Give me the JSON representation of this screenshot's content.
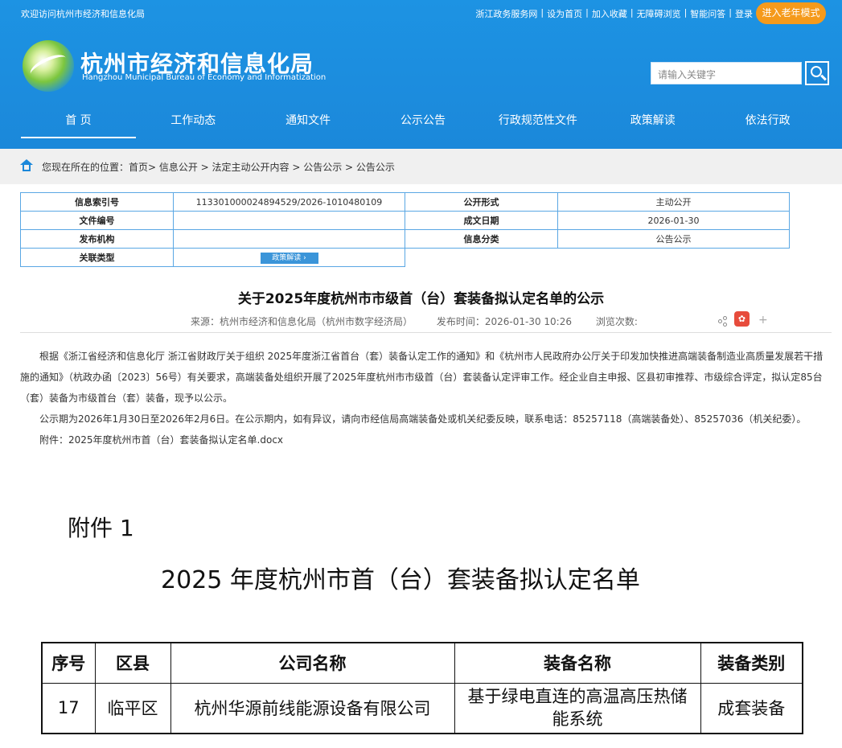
{
  "topbar": {
    "welcome": "欢迎访问杭州市经济和信息化局",
    "links": [
      "浙江政务服务网",
      "设为首页",
      "加入收藏",
      "无障碍浏览",
      "智能问答",
      "登录"
    ],
    "elder_mode": "进入老年模式"
  },
  "site": {
    "title": "杭州市经济和信息化局",
    "subtitle": "Hangzhou Municipal Bureau of Economy and Informatization"
  },
  "search": {
    "placeholder": "请输入关键字"
  },
  "nav": [
    "首 页",
    "工作动态",
    "通知文件",
    "公示公告",
    "行政规范性文件",
    "政策解读",
    "依法行政"
  ],
  "breadcrumb": "您现在所在的位置：首页> 信息公开 > 法定主动公开内容 > 公告公示 > 公告公示",
  "info": {
    "labels": [
      "信息索引号",
      "公开形式",
      "文件编号",
      "成文日期",
      "发布机构",
      "信息分类",
      "关联类型"
    ],
    "index_no": "113301000024894529/2026-1010480109",
    "open_form": "主动公开",
    "doc_no": "",
    "date": "2026-01-30",
    "issuer": "",
    "category": "公告公示",
    "policy_button": "政策解读 ›"
  },
  "article": {
    "title": "关于2025年度杭州市市级首（台）套装备拟认定名单的公示",
    "source": "来源：杭州市经济和信息化局（杭州市数字经济局）",
    "time": "发布时间：2026-01-30 10:26",
    "views": "浏览次数:",
    "para1": "根据《浙江省经济和信息化厅 浙江省财政厅关于组织 2025年度浙江省首台（套）装备认定工作的通知》和《杭州市人民政府办公厅关于印发加快推进高端装备制造业高质量发展若干措施的通知》（杭政办函〔2023〕56号）有关要求，高端装备处组织开展了2025年度杭州市市级首（台）套装备认定评审工作。经企业自主申报、区县初审推荐、市级综合评定，拟认定85台（套）装备为市级首台（套）装备，现予以公示。",
    "para2": "公示期为2026年1月30日至2026年2月6日。在公示期内，如有异议，请向市经信局高端装备处或机关纪委反映，联系电话：85257118（高端装备处）、85257036（机关纪委）。",
    "attachment": "附件：2025年度杭州市首（台）套装备拟认定名单.docx"
  },
  "attachment_image": {
    "label": "附件 1",
    "title": "2025 年度杭州市首（台）套装备拟认定名单",
    "headers": [
      "序号",
      "区县",
      "公司名称",
      "装备名称",
      "装备类别"
    ],
    "row": [
      "17",
      "临平区",
      "杭州华源前线能源设备有限公司",
      "基于绿电直连的高温高压热储能系统",
      "成套装备"
    ]
  },
  "colors": {
    "header_blue": "#1b88da",
    "elder_orange": "#f59a1b",
    "table_border": "#5aa7e4"
  }
}
